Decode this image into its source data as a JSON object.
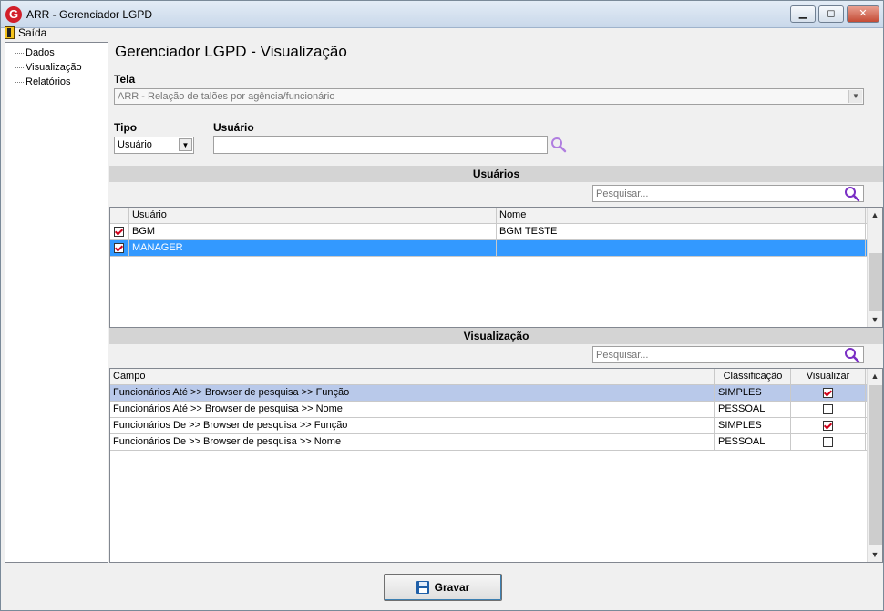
{
  "window": {
    "title": "ARR - Gerenciador LGPD",
    "app_icon_letter": "G",
    "minimize_label": "▁",
    "maximize_label": "◻",
    "close_label": "✕"
  },
  "menu": {
    "exit_label": "Saída"
  },
  "sidebar": {
    "items": [
      {
        "label": "Dados"
      },
      {
        "label": "Visualização"
      },
      {
        "label": "Relatórios"
      }
    ]
  },
  "page": {
    "title": "Gerenciador LGPD - Visualização"
  },
  "form": {
    "tela_label": "Tela",
    "tela_value": "ARR - Relação de talões por agência/funcionário",
    "tipo_label": "Tipo",
    "tipo_value": "Usuário",
    "usuario_label": "Usuário",
    "usuario_value": ""
  },
  "users_section": {
    "title": "Usuários",
    "search_placeholder": "Pesquisar...",
    "columns": {
      "user": "Usuário",
      "name": "Nome"
    },
    "rows": [
      {
        "checked": true,
        "user": "BGM",
        "name": "BGM TESTE"
      },
      {
        "checked": true,
        "user": "MANAGER",
        "name": ""
      }
    ]
  },
  "view_section": {
    "title": "Visualização",
    "search_placeholder": "Pesquisar...",
    "columns": {
      "field": "Campo",
      "classification": "Classificação",
      "visualize": "Visualizar"
    },
    "rows": [
      {
        "field": "Funcionários Até >> Browser de pesquisa >> Função",
        "classification": "SIMPLES",
        "visualize": true
      },
      {
        "field": "Funcionários Até >> Browser de pesquisa >> Nome",
        "classification": "PESSOAL",
        "visualize": false
      },
      {
        "field": "Funcionários De >> Browser de pesquisa >> Função",
        "classification": "SIMPLES",
        "visualize": true
      },
      {
        "field": "Funcionários De >> Browser de pesquisa >> Nome",
        "classification": "PESSOAL",
        "visualize": false
      }
    ]
  },
  "actions": {
    "save_label": "Gravar"
  },
  "icons": {
    "app": "app-logo-icon",
    "exit": "door-exit-icon",
    "search": "magnifier-icon",
    "save": "floppy-disk-icon"
  },
  "colors": {
    "selection": "#3399ff",
    "highlight_row": "#b9c9ea",
    "search_icon": "#7a2fc4",
    "check_mark": "#d0021b"
  }
}
